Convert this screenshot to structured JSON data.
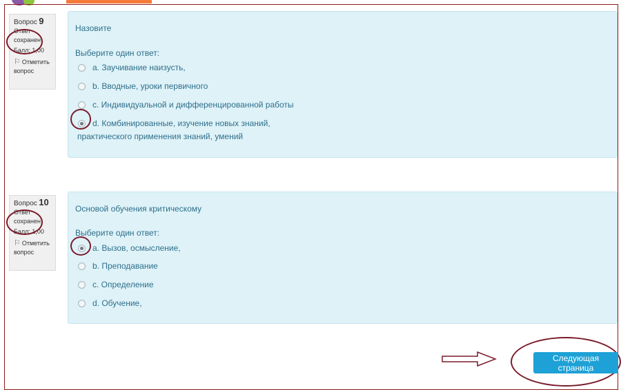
{
  "questions": [
    {
      "label": "Вопрос",
      "number": "9",
      "state": "Ответ сохранен",
      "mark": "Балл: 1,00",
      "flag_label": "Отметить вопрос",
      "text": "Назовите",
      "prompt": "Выберите один ответ:",
      "options": [
        {
          "text": "a. Заучивание наизусть,",
          "checked": false
        },
        {
          "text": "b. Вводные, уроки первичного",
          "checked": false
        },
        {
          "text": "c. Индивидуальной и дифференцированной работы",
          "checked": false
        },
        {
          "text": "d. Комбинированные, изучение новых знаний,",
          "text2": "практического применения знаний, умений",
          "checked": true
        }
      ]
    },
    {
      "label": "Вопрос",
      "number": "10",
      "state": "Ответ сохранен",
      "mark": "Балл: 1,00",
      "flag_label": "Отметить вопрос",
      "text": "Основой обучения критическому",
      "prompt": "Выберите один ответ:",
      "options": [
        {
          "text": "a. Вызов, осмысление,",
          "checked": true
        },
        {
          "text": "b. Преподавание",
          "checked": false
        },
        {
          "text": "c. Определение",
          "checked": false
        },
        {
          "text": "d. Обучение,",
          "checked": false
        }
      ]
    }
  ],
  "next_button": "Следующая страница",
  "colors": {
    "question_bg": "#def2f8",
    "question_text": "#2f6f8a",
    "button_bg": "#1ea1d6",
    "annotation": "#7a1a2a"
  }
}
